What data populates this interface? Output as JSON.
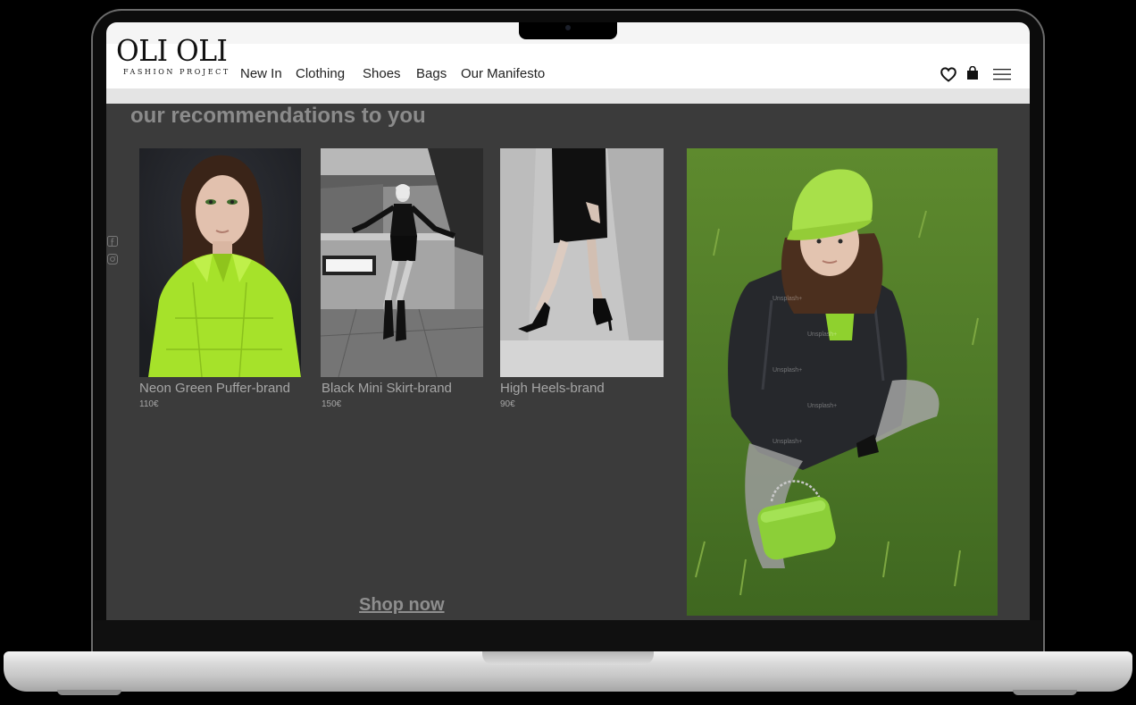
{
  "brand": {
    "logo_text": "OLI OLI",
    "tagline": "FASHION PROJECT"
  },
  "nav": {
    "items": [
      {
        "label": "New In"
      },
      {
        "label": "Clothing"
      },
      {
        "label": "Shoes"
      },
      {
        "label": "Bags"
      },
      {
        "label": "Our Manifesto"
      }
    ]
  },
  "header_icons": [
    "heart-icon",
    "shopping-bag-icon",
    "menu-icon"
  ],
  "social_icons": [
    "facebook-icon",
    "instagram-icon"
  ],
  "recommendations": {
    "title": "our recommendations to you",
    "products": [
      {
        "name": "Neon Green Puffer-brand",
        "price": "110€"
      },
      {
        "name": "Black Mini Skirt-brand",
        "price": "150€"
      },
      {
        "name": "High Heels-brand",
        "price": "90€"
      }
    ],
    "cta": "Shop now"
  },
  "colors": {
    "page_bg": "#3b3b3b",
    "accent_green": "#9be02a",
    "muted_text": "#a6a6a6"
  }
}
